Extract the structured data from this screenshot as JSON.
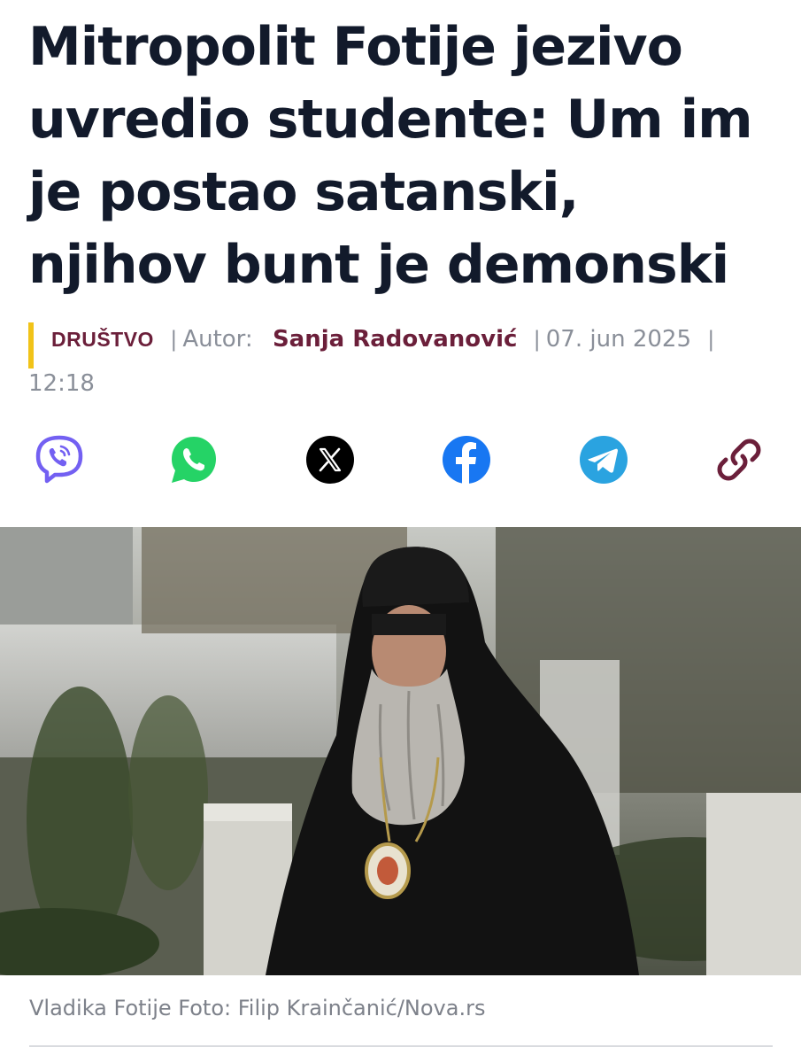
{
  "article": {
    "title_lines": [
      "Mitropolit Fotije jezivo",
      "uvredio studente: Um im",
      "je postao satanski,",
      "njihov bunt je demonski"
    ],
    "category": "DRUŠTVO",
    "author_label": "Autor:",
    "author": "Sanja Radovanović",
    "date": "07. jun 2025",
    "time": "12:18",
    "separator": "|",
    "photo_caption": "Vladika Fotije Foto: Filip Krainčanić/Nova.rs"
  },
  "share": {
    "buttons": [
      {
        "name": "viber",
        "icon": "viber-icon",
        "color": "#7360f2"
      },
      {
        "name": "whatsapp",
        "icon": "whatsapp-icon",
        "color": "#25d366"
      },
      {
        "name": "x",
        "icon": "x-icon",
        "color": "#000000"
      },
      {
        "name": "facebook",
        "icon": "facebook-icon",
        "color": "#1877f2"
      },
      {
        "name": "telegram",
        "icon": "telegram-icon",
        "color": "#2aa3e0"
      },
      {
        "name": "copy-link",
        "icon": "link-icon",
        "color": "#6b1f3a"
      }
    ]
  },
  "colors": {
    "accent": "#6b1f3a",
    "category_bar": "#f1c318",
    "meta_text": "#8a8f99"
  }
}
